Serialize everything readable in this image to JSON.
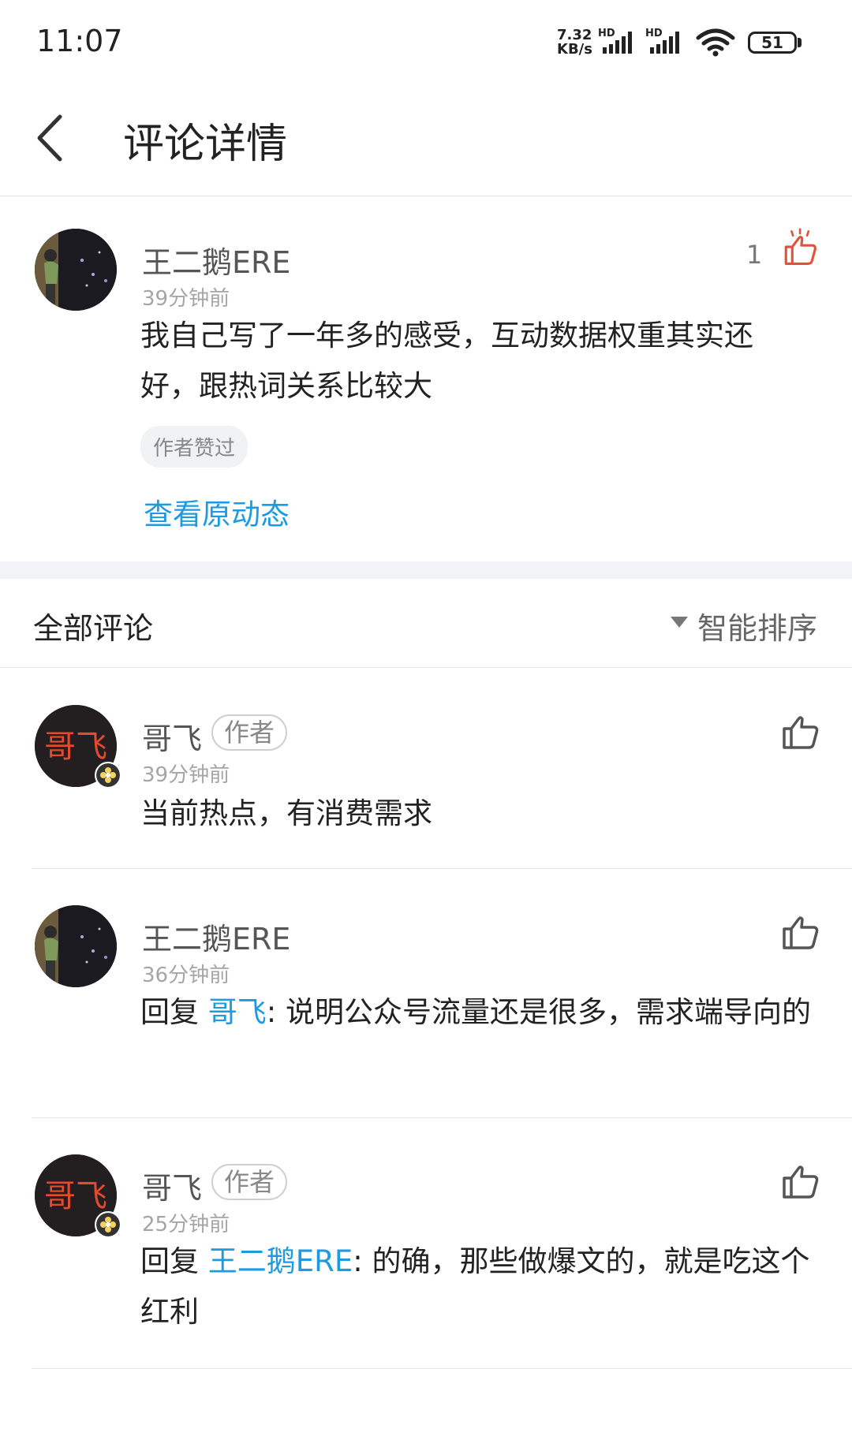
{
  "status_bar": {
    "time": "11:07",
    "net_speed_value": "7.32",
    "net_speed_unit": "KB/s",
    "signal1_label": "HD",
    "signal2_label": "HD",
    "battery": "51"
  },
  "header": {
    "title": "评论详情"
  },
  "main_comment": {
    "user": "王二鹅ERE",
    "time": "39分钟前",
    "text": "我自己写了一年多的感受，互动数据权重其实还好，跟热词关系比较大",
    "tag": "作者赞过",
    "like_count": "1",
    "view_original": "查看原动态"
  },
  "section": {
    "title": "全部评论",
    "sort_label": "智能排序"
  },
  "replies": [
    {
      "user": "哥飞",
      "badge": "作者",
      "time": "39分钟前",
      "prefix": "",
      "mention": "",
      "text": "当前热点，有消费需求"
    },
    {
      "user": "王二鹅ERE",
      "badge": "",
      "time": "36分钟前",
      "prefix": "回复 ",
      "mention": "哥飞",
      "text": ": 说明公众号流量还是很多，需求端导向的"
    },
    {
      "user": "哥飞",
      "badge": "作者",
      "time": "25分钟前",
      "prefix": "回复 ",
      "mention": "王二鹅ERE",
      "text": ": 的确，那些做爆文的，就是吃这个红利"
    }
  ],
  "avatar_text": "哥飞",
  "colors": {
    "accent_blue": "#1e9be0",
    "like_red": "#e0533a"
  }
}
